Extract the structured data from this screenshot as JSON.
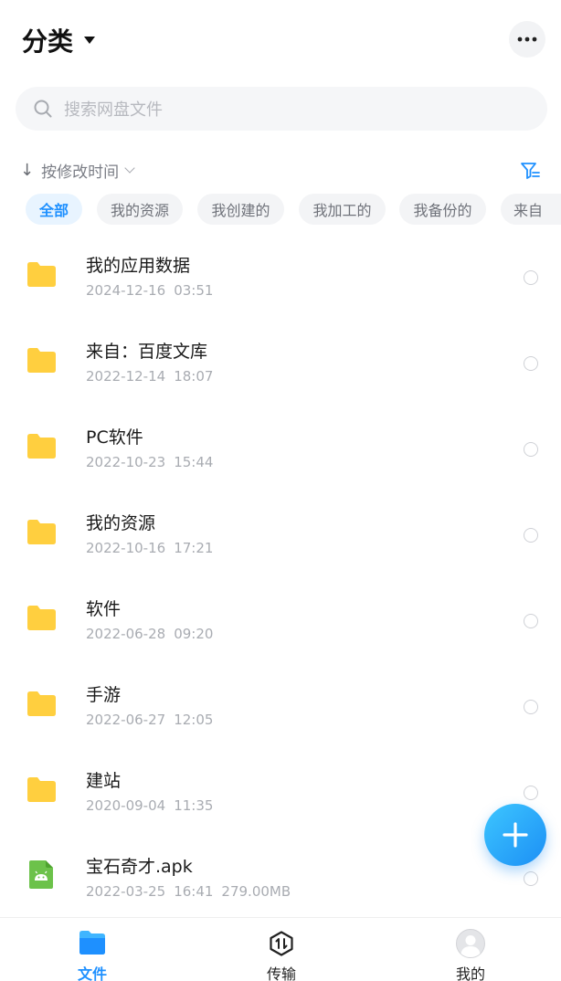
{
  "header": {
    "title": "分类",
    "more_icon": "more-horizontal-icon"
  },
  "search": {
    "placeholder": "搜索网盘文件"
  },
  "sort": {
    "label": "按修改时间"
  },
  "chips": [
    "全部",
    "我的资源",
    "我创建的",
    "我加工的",
    "我备份的",
    "来自"
  ],
  "files": [
    {
      "name": "我的应用数据",
      "date": "2024-12-16",
      "time": "03:51",
      "size": "",
      "type": "folder"
    },
    {
      "name": "来自：百度文库",
      "date": "2022-12-14",
      "time": "18:07",
      "size": "",
      "type": "folder"
    },
    {
      "name": "PC软件",
      "date": "2022-10-23",
      "time": "15:44",
      "size": "",
      "type": "folder"
    },
    {
      "name": "我的资源",
      "date": "2022-10-16",
      "time": "17:21",
      "size": "",
      "type": "folder"
    },
    {
      "name": "软件",
      "date": "2022-06-28",
      "time": "09:20",
      "size": "",
      "type": "folder"
    },
    {
      "name": "手游",
      "date": "2022-06-27",
      "time": "12:05",
      "size": "",
      "type": "folder"
    },
    {
      "name": "建站",
      "date": "2020-09-04",
      "time": "11:35",
      "size": "",
      "type": "folder"
    },
    {
      "name": "宝石奇才.apk",
      "date": "2022-03-25",
      "time": "16:41",
      "size": "279.00MB",
      "type": "apk"
    }
  ],
  "tabs": [
    {
      "label": "文件",
      "icon": "folder-icon",
      "active": true
    },
    {
      "label": "传输",
      "icon": "transfer-icon",
      "active": false
    },
    {
      "label": "我的",
      "icon": "avatar-icon",
      "active": false
    }
  ],
  "colors": {
    "accent": "#1e90ff",
    "folder": "#ffcf3f",
    "apk": "#6cc24a"
  }
}
